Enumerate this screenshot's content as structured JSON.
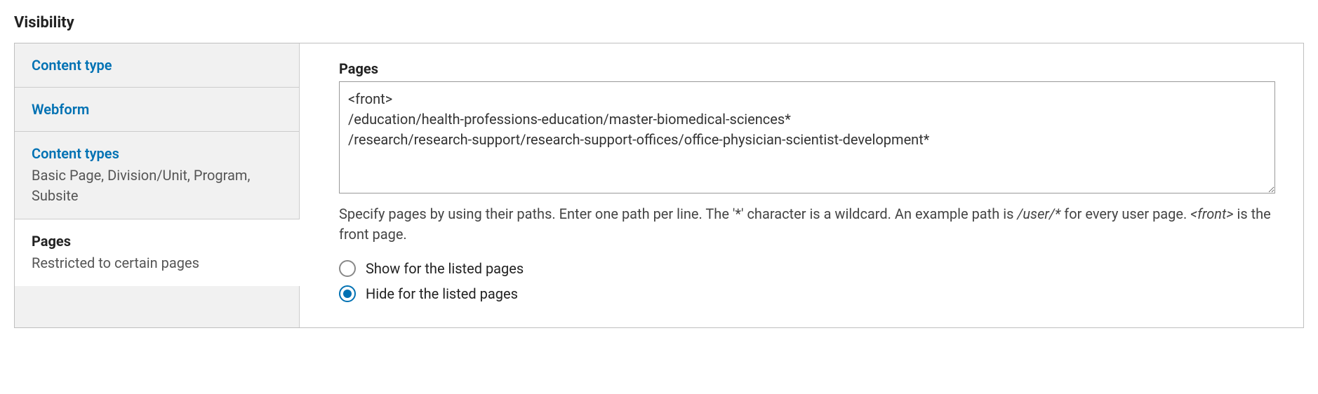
{
  "section_title": "Visibility",
  "tabs": [
    {
      "title": "Content type",
      "summary": ""
    },
    {
      "title": "Webform",
      "summary": ""
    },
    {
      "title": "Content types",
      "summary": "Basic Page, Division/Unit, Program, Subsite"
    },
    {
      "title": "Pages",
      "summary": "Restricted to certain pages"
    }
  ],
  "content": {
    "pages_label": "Pages",
    "pages_value": "<front>\n/education/health-professions-education/master-biomedical-sciences*\n/research/research-support/research-support-offices/office-physician-scientist-development*",
    "description_pre": "Specify pages by using their paths. Enter one path per line. The '*' character is a wildcard. An example path is ",
    "description_em1": "/user/*",
    "description_mid": " for every user page. ",
    "description_em2": "<front>",
    "description_post": " is the front page.",
    "radio_show": "Show for the listed pages",
    "radio_hide": "Hide for the listed pages"
  }
}
